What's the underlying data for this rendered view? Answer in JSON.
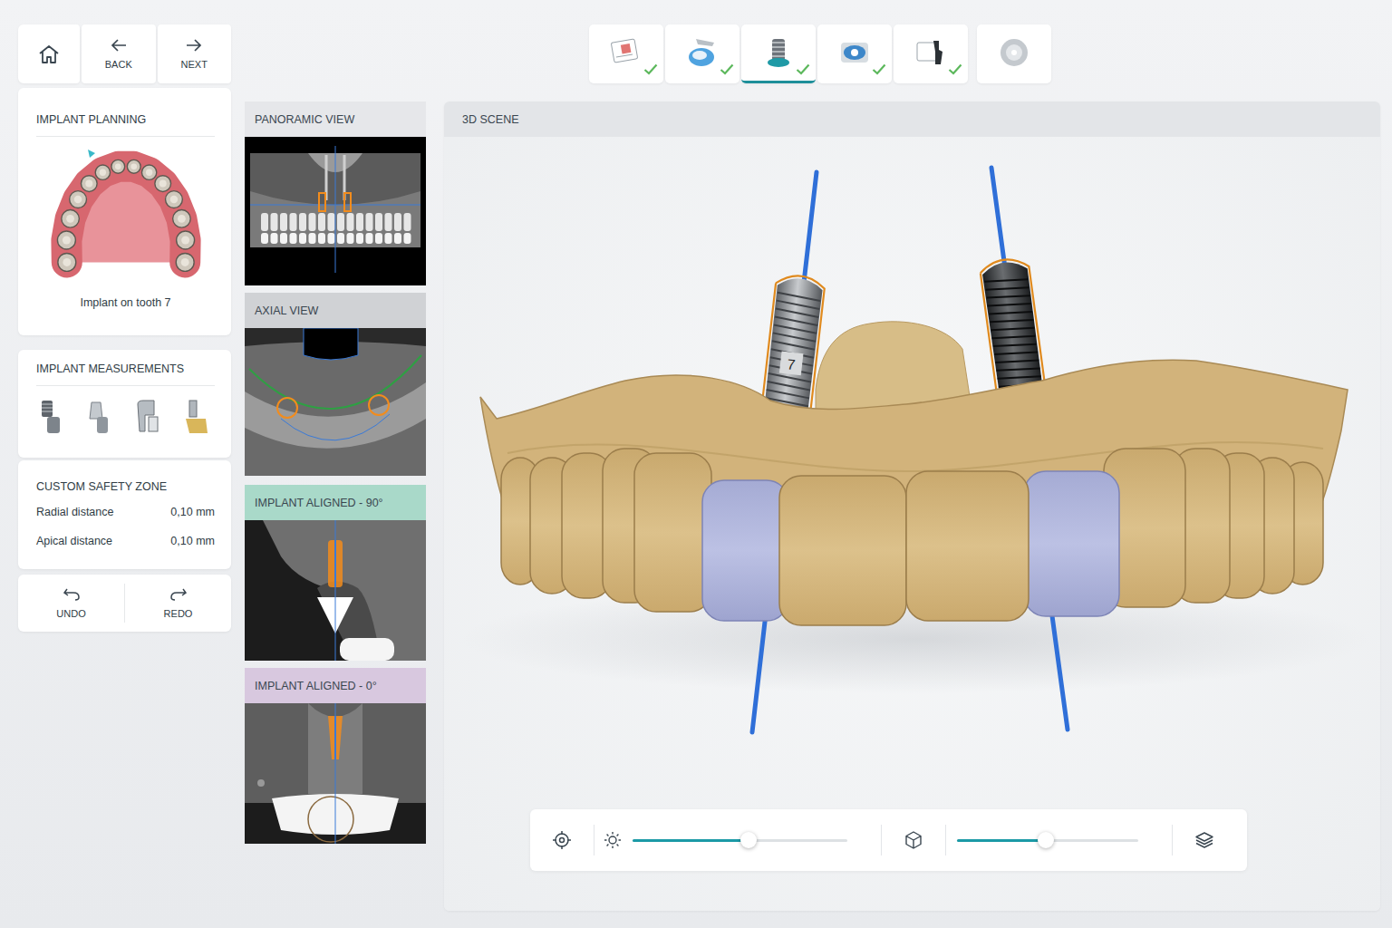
{
  "nav": {
    "back": "BACK",
    "next": "NEXT"
  },
  "steps": [
    {
      "done": true,
      "selected": false
    },
    {
      "done": true,
      "selected": false
    },
    {
      "done": true,
      "selected": true
    },
    {
      "done": true,
      "selected": false
    },
    {
      "done": true,
      "selected": false
    },
    {
      "done": false,
      "selected": false
    }
  ],
  "planning": {
    "title": "IMPLANT PLANNING",
    "caption": "Implant on tooth 7"
  },
  "measurements": {
    "title": "IMPLANT MEASUREMENTS"
  },
  "safety_zone": {
    "title": "CUSTOM SAFETY ZONE",
    "rows": [
      {
        "label": "Radial distance",
        "value": "0,10 mm"
      },
      {
        "label": "Apical distance",
        "value": "0,10 mm"
      }
    ]
  },
  "history": {
    "undo": "UNDO",
    "redo": "REDO"
  },
  "views": [
    {
      "title": "PANORAMIC VIEW",
      "kind": "panoramic",
      "color": "#e6e7ea"
    },
    {
      "title": "AXIAL VIEW",
      "kind": "axial",
      "color": "#d0d2d5"
    },
    {
      "title": "IMPLANT ALIGNED - 90°",
      "kind": "aligned90",
      "color": "#a9d9c9"
    },
    {
      "title": "IMPLANT ALIGNED - 0°",
      "kind": "aligned0",
      "color": "#d8c8df"
    }
  ],
  "scene": {
    "title": "3D SCENE",
    "implants": [
      {
        "label": "7",
        "selected": true
      },
      {
        "label": null,
        "selected": false
      }
    ],
    "teeth": [
      {
        "planned": false
      },
      {
        "planned": false
      },
      {
        "planned": false
      },
      {
        "planned": false
      },
      {
        "planned": false
      },
      {
        "planned": true
      },
      {
        "planned": false
      },
      {
        "planned": false
      },
      {
        "planned": true
      },
      {
        "planned": false
      },
      {
        "planned": false
      },
      {
        "planned": false
      },
      {
        "planned": false
      },
      {
        "planned": false
      }
    ],
    "brightness": {
      "level": 0.54
    },
    "opacity": {
      "level": 0.49
    }
  }
}
